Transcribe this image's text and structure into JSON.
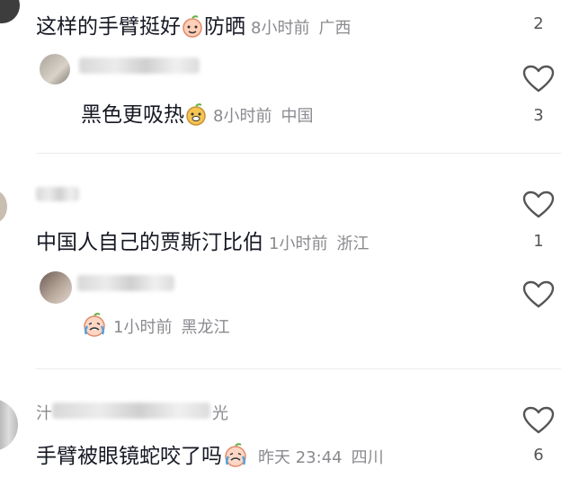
{
  "comments": [
    {
      "text": "这样的手臂挺好",
      "emoji": "peach-face-emoji",
      "text_after": "防晒",
      "time": "8小时前",
      "location": "广西",
      "likes": "2"
    },
    {
      "text": "黑色更吸热",
      "emoji": "doge-emoji",
      "text_after": "",
      "time": "8小时前",
      "location": "中国",
      "likes": "3"
    },
    {
      "text": "中国人自己的贾斯汀比伯",
      "time": "1小时前",
      "location": "浙江",
      "likes": "1"
    },
    {
      "emoji": "crying-emoji",
      "text": "",
      "time": "1小时前",
      "location": "黑龙江",
      "likes": ""
    },
    {
      "username_visible_start": "汁",
      "username_visible_end": "光",
      "text": "手臂被眼镜蛇咬了吗",
      "emoji": "crying-emoji",
      "time": "昨天 23:44",
      "location": "四川",
      "likes": "6"
    }
  ],
  "colors": {
    "text": "#161823",
    "meta": "#8a8a8f",
    "icon": "#555555",
    "emoji_face": "#ffd6c4"
  }
}
